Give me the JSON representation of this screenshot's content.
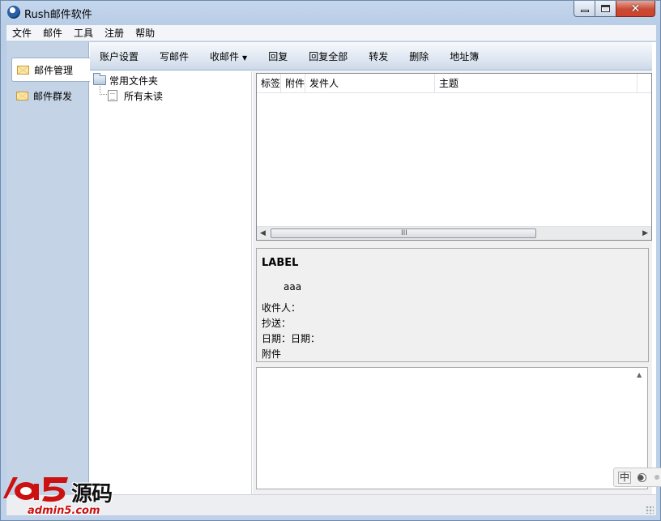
{
  "window": {
    "title": "Rush邮件软件",
    "icon": "app-e-icon"
  },
  "menubar": {
    "items": [
      "文件",
      "邮件",
      "工具",
      "注册",
      "帮助"
    ]
  },
  "leftnav": {
    "items": [
      {
        "label": "邮件管理",
        "icon": "envelope-icon",
        "selected": true
      },
      {
        "label": "邮件群发",
        "icon": "envelope-icon",
        "selected": false
      }
    ]
  },
  "toolbar": {
    "account_settings": "账户设置",
    "compose": "写邮件",
    "receive": "收邮件",
    "receive_arrow": "▼",
    "reply": "回复",
    "reply_all": "回复全部",
    "forward": "转发",
    "delete": "删除",
    "address_book": "地址簿"
  },
  "folder_tree": {
    "root_label": "常用文件夹",
    "children": [
      "所有未读"
    ]
  },
  "message_list": {
    "columns": [
      "标签",
      "附件",
      "发件人",
      "主题"
    ],
    "rows": [],
    "scroll_grip": "III",
    "scroll_left": "◀",
    "scroll_right": "▶"
  },
  "message_detail": {
    "label": "LABEL",
    "subject": "aaa",
    "to_label": "收件人：",
    "cc_label": "抄送：",
    "date_label": "日期：日期：",
    "attachment_label": "附件"
  },
  "ime": {
    "mode": "中"
  },
  "watermark": {
    "brand_cn": "源码",
    "url": "admin5.com"
  },
  "colors": {
    "accent": "#c4d3e5",
    "logo_red": "#cc1111",
    "close_red": "#c74b35"
  }
}
